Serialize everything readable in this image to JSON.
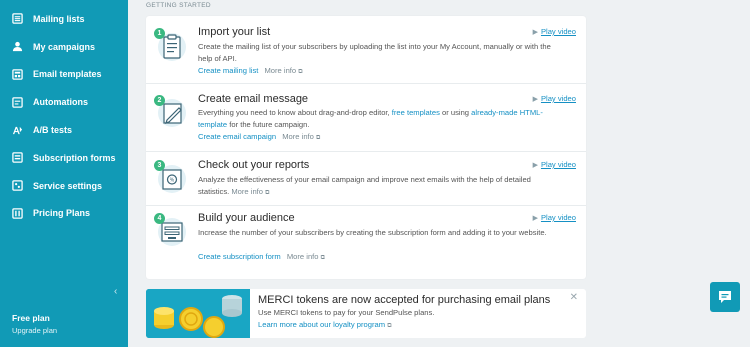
{
  "sidebar": {
    "items": [
      {
        "label": "Mailing lists",
        "icon": "list-icon"
      },
      {
        "label": "My campaigns",
        "icon": "user-icon"
      },
      {
        "label": "Email templates",
        "icon": "template-icon"
      },
      {
        "label": "Automations",
        "icon": "automation-icon"
      },
      {
        "label": "A/B tests",
        "icon": "ab-test-icon"
      },
      {
        "label": "Subscription forms",
        "icon": "form-icon"
      },
      {
        "label": "Service settings",
        "icon": "settings-icon"
      },
      {
        "label": "Pricing Plans",
        "icon": "pricing-icon"
      }
    ],
    "collapse_icon": "‹",
    "plan_name": "Free plan",
    "upgrade_label": "Upgrade plan"
  },
  "main": {
    "section_title": "GETTING STARTED",
    "play_label": "Play video",
    "more_label": "More info",
    "steps": [
      {
        "number": "1",
        "title": "Import your list",
        "desc": "Create the mailing list of your subscribers by uploading the list into your My Account, manually or with the help of API.",
        "link": "Create mailing list"
      },
      {
        "number": "2",
        "title": "Create email message",
        "desc_pre": "Everything you need to know about drag-and-drop editor, ",
        "desc_link1": "free templates",
        "desc_mid": " or using ",
        "desc_link2": "already-made HTML-template",
        "desc_post": " for the future campaign.",
        "link": "Create email campaign"
      },
      {
        "number": "3",
        "title": "Check out your reports",
        "desc": "Analyze the effectiveness of your email campaign and improve next emails with the help of detailed statistics.",
        "link": ""
      },
      {
        "number": "4",
        "title": "Build your audience",
        "desc": "Increase the number of your subscribers by creating the subscription form and adding it to your website.",
        "link": "Create subscription form"
      }
    ]
  },
  "promo": {
    "title": "MERCI tokens are now accepted for purchasing email plans",
    "subtitle": "Use MERCI tokens to pay for your SendPulse plans.",
    "link": "Learn more about our loyalty program",
    "close": "✕"
  },
  "colors": {
    "sidebar": "#119ab6",
    "accent": "#1590c4",
    "step_badge": "#3ab881"
  }
}
